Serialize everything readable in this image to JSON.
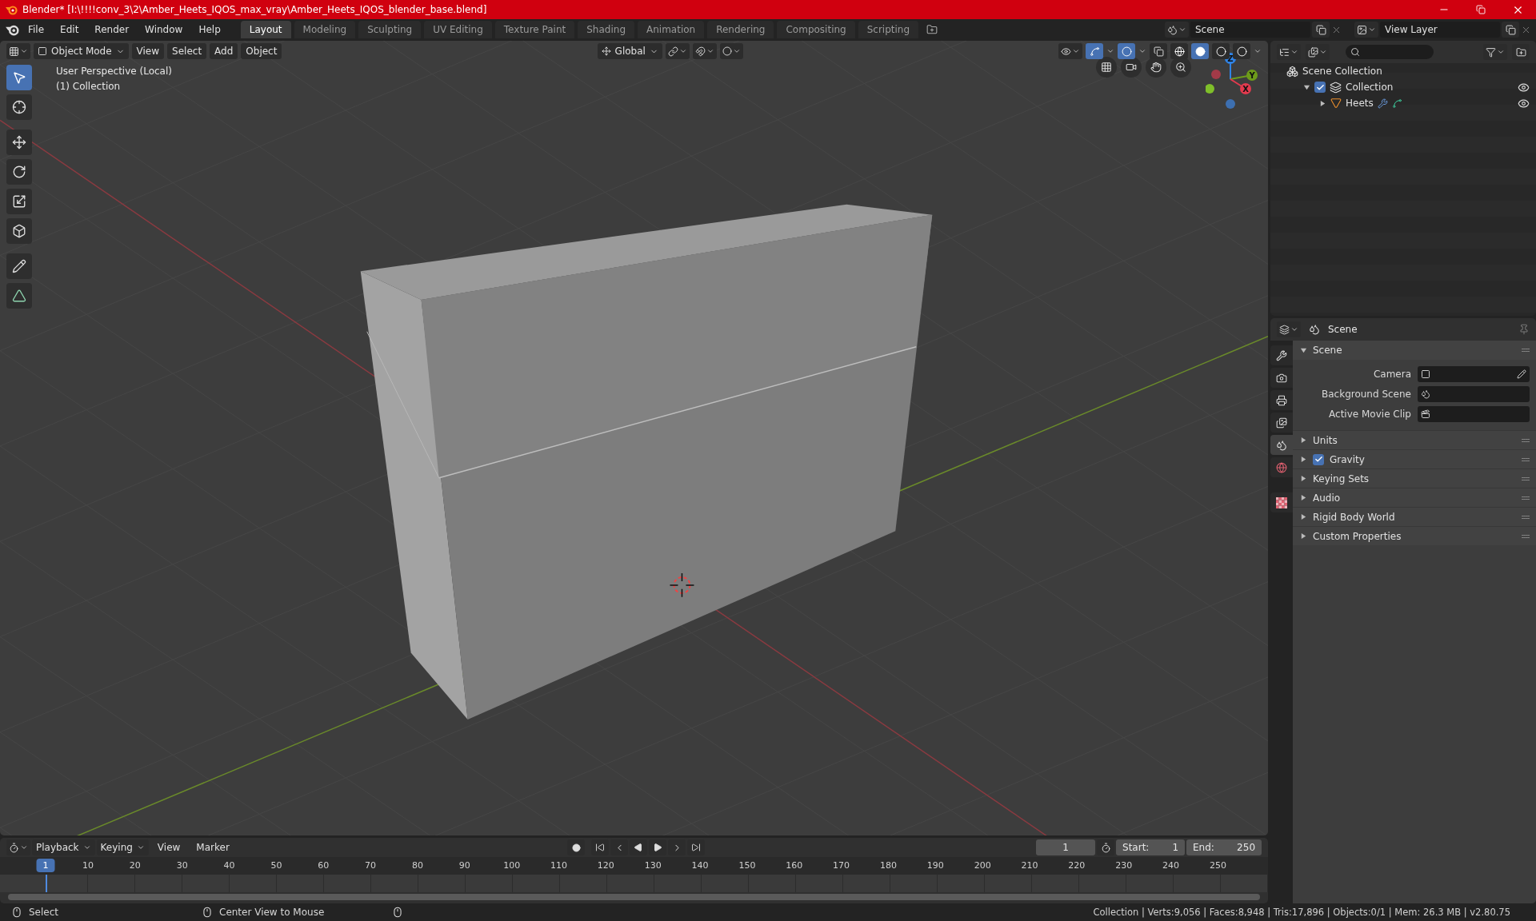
{
  "window": {
    "title": "Blender* [I:\\!!!!conv_3\\2\\Amber_Heets_IQOS_max_vray\\Amber_Heets_IQOS_blender_base.blend]"
  },
  "menu": [
    "File",
    "Edit",
    "Render",
    "Window",
    "Help"
  ],
  "workspace_tabs": [
    {
      "label": "Layout",
      "selected": true
    },
    {
      "label": "Modeling",
      "selected": false
    },
    {
      "label": "Sculpting",
      "selected": false
    },
    {
      "label": "UV Editing",
      "selected": false
    },
    {
      "label": "Texture Paint",
      "selected": false
    },
    {
      "label": "Shading",
      "selected": false
    },
    {
      "label": "Animation",
      "selected": false
    },
    {
      "label": "Rendering",
      "selected": false
    },
    {
      "label": "Compositing",
      "selected": false
    },
    {
      "label": "Scripting",
      "selected": false
    }
  ],
  "scene_field": {
    "value": "Scene"
  },
  "view_layer_field": {
    "value": "View Layer"
  },
  "viewport": {
    "mode": "Object Mode",
    "menus": [
      "View",
      "Select",
      "Add",
      "Object"
    ],
    "orientation": "Global",
    "shading": [
      {
        "selected": false
      },
      {
        "selected": true
      },
      {
        "selected": false
      },
      {
        "selected": false
      }
    ],
    "overlay_text": [
      "User Perspective (Local)",
      "(1) Collection"
    ],
    "tools": [
      {
        "selected": true
      },
      {
        "selected": false
      },
      {
        "selected": false
      },
      {
        "selected": false
      },
      {
        "selected": false
      },
      {
        "selected": false
      },
      {
        "selected": false
      },
      {
        "selected": false
      }
    ],
    "gizmo_axes": [
      "Z",
      "Y",
      "X"
    ]
  },
  "outliner": {
    "items": [
      {
        "label": "Scene Collection",
        "children": [
          {
            "label": "Collection",
            "checked": true,
            "expanded": true,
            "visible": true,
            "children": [
              {
                "label": "Heets",
                "expanded": false,
                "visible": true
              }
            ]
          }
        ]
      }
    ]
  },
  "properties": {
    "title": "Scene",
    "tabs": [
      {
        "selected": false
      },
      {
        "selected": false
      },
      {
        "selected": false
      },
      {
        "selected": false
      },
      {
        "selected": true
      },
      {
        "selected": false
      },
      {
        "selected": false
      }
    ],
    "panel": {
      "label": "Scene",
      "expanded": true,
      "fields": [
        {
          "label": "Camera"
        },
        {
          "label": "Background Scene"
        },
        {
          "label": "Active Movie Clip"
        }
      ]
    },
    "subpanels": [
      {
        "label": "Units",
        "kind": "plain",
        "expanded": false
      },
      {
        "label": "Gravity",
        "kind": "checkbox",
        "expanded": false,
        "checked": true
      },
      {
        "label": "Keying Sets",
        "kind": "plain",
        "expanded": false
      },
      {
        "label": "Audio",
        "kind": "plain",
        "expanded": false
      },
      {
        "label": "Rigid Body World",
        "kind": "plain",
        "expanded": false
      },
      {
        "label": "Custom Properties",
        "kind": "plain",
        "expanded": false
      }
    ]
  },
  "timeline": {
    "menus": [
      {
        "label": "Playback",
        "kind": "dropdown"
      },
      {
        "label": "Keying",
        "kind": "dropdown"
      },
      {
        "label": "View",
        "kind": "plain"
      },
      {
        "label": "Marker",
        "kind": "plain"
      }
    ],
    "current_frame": "1",
    "start_label": "Start:",
    "start": "1",
    "end_label": "End:",
    "end": "250",
    "playhead": "1",
    "ticks": [
      "10",
      "20",
      "30",
      "40",
      "50",
      "60",
      "70",
      "80",
      "90",
      "100",
      "110",
      "120",
      "130",
      "140",
      "150",
      "160",
      "170",
      "180",
      "190",
      "200",
      "210",
      "220",
      "230",
      "240",
      "250"
    ]
  },
  "status_bar": {
    "hints": [
      "Select",
      "Center View to Mouse"
    ],
    "stats": "Collection | Verts:9,056 | Faces:8,948 | Tris:17,896 | Objects:0/1 | Mem: 26.3 MB | v2.80.75"
  }
}
